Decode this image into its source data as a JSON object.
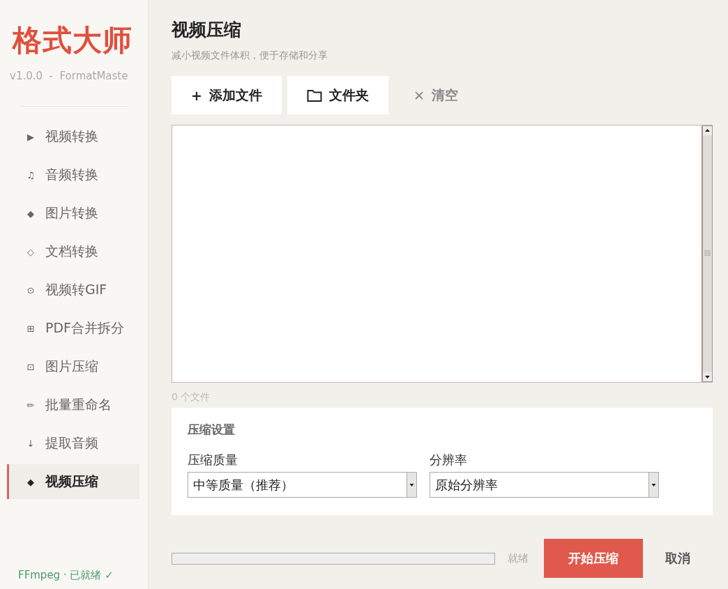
{
  "sidebar": {
    "logo": "格式大师",
    "version": "v1.0.0  -  FormatMaste",
    "items": [
      {
        "icon": "▶",
        "label": "视频转换",
        "selected": false
      },
      {
        "icon": "♫",
        "label": "音频转换",
        "selected": false
      },
      {
        "icon": "◆",
        "label": "图片转换",
        "selected": false
      },
      {
        "icon": "◇",
        "label": "文档转换",
        "selected": false
      },
      {
        "icon": "⊙",
        "label": "视频转GIF",
        "selected": false
      },
      {
        "icon": "⊞",
        "label": "PDF合并拆分",
        "selected": false
      },
      {
        "icon": "⊡",
        "label": "图片压缩",
        "selected": false
      },
      {
        "icon": "✏",
        "label": "批量重命名",
        "selected": false
      },
      {
        "icon": "↓",
        "label": "提取音频",
        "selected": false
      },
      {
        "icon": "◆",
        "label": "视频压缩",
        "selected": true
      }
    ],
    "status": "FFmpeg · 已就绪 ✓"
  },
  "header": {
    "title": "视频压缩",
    "subtitle": "减小视频文件体积，便于存储和分享"
  },
  "toolbar": [
    {
      "kind": "add",
      "icon": "+",
      "label": "添加文件"
    },
    {
      "kind": "folder",
      "label": "文件夹"
    },
    {
      "kind": "clear",
      "icon": "✕",
      "label": "清空"
    }
  ],
  "file_count": "0 个文件",
  "settings": {
    "title": "压缩设置",
    "fields": [
      {
        "label": "压缩质量",
        "value": "中等质量（推荐）"
      },
      {
        "label": "分辨率",
        "value": "原始分辨率"
      }
    ]
  },
  "footer": {
    "progress": {
      "level": 0
    },
    "status": "就绪",
    "start": "开始压缩",
    "cancel": "取消"
  }
}
